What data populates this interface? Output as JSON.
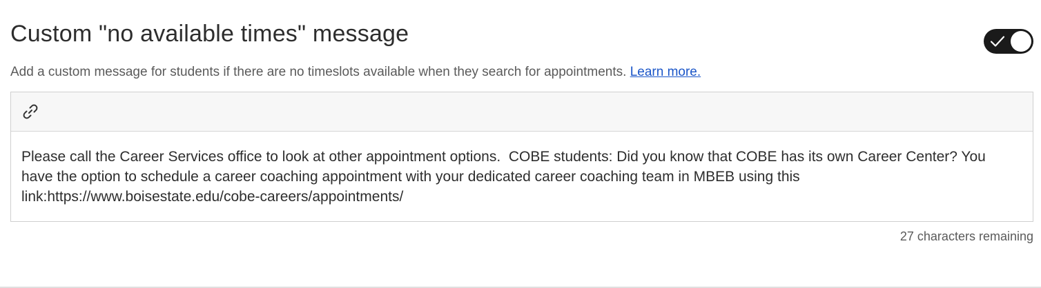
{
  "section": {
    "title": "Custom \"no available times\" message",
    "toggle": {
      "state": "on",
      "icon": "check-icon"
    },
    "description": "Add a custom message for students if there are no timeslots available when they search for appointments.",
    "learn_more_label": "Learn more."
  },
  "editor": {
    "toolbar": {
      "link_icon": "link-icon"
    },
    "content": "Please call the Career Services office to look at other appointment options.  COBE students: Did you know that COBE has its own Career Center? You have the option to schedule a career coaching appointment with your dedicated career coaching team in MBEB using this link:https://www.boisestate.edu/cobe-careers/appointments/",
    "remaining": "27 characters remaining"
  },
  "colors": {
    "toggle_on": "#1a1a1a",
    "link": "#1a55c8",
    "text": "#2d2d2d",
    "muted": "#5a5a5a"
  }
}
